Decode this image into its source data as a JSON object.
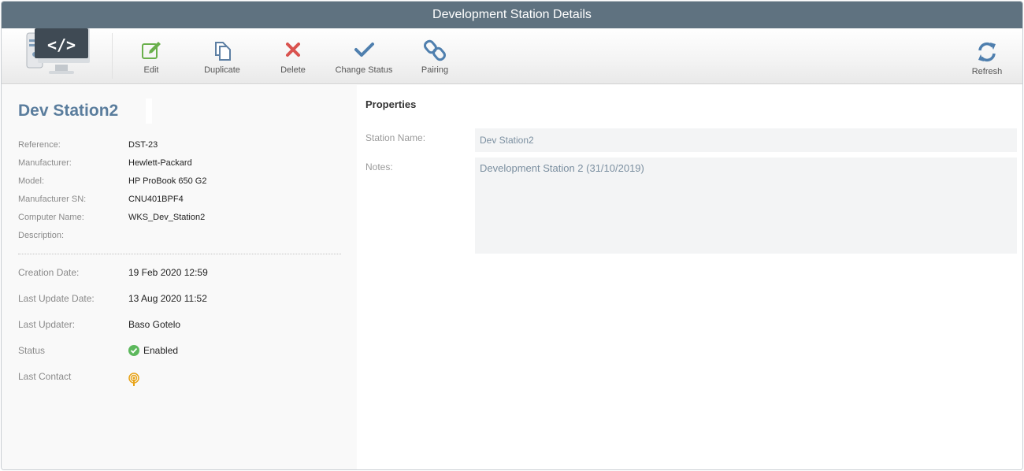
{
  "window": {
    "title": "Development Station Details"
  },
  "toolbar": {
    "buttons": [
      {
        "label": "Edit",
        "icon": "edit-icon",
        "color": "#6ab04c"
      },
      {
        "label": "Duplicate",
        "icon": "duplicate-icon",
        "color": "#5d7fa3"
      },
      {
        "label": "Delete",
        "icon": "delete-icon",
        "color": "#d9534f"
      },
      {
        "label": "Change Status",
        "icon": "check-icon",
        "color": "#4f7fae"
      },
      {
        "label": "Pairing",
        "icon": "link-icon",
        "color": "#4f7fae"
      }
    ],
    "refresh_label": "Refresh"
  },
  "station": {
    "name": "Dev Station2",
    "details": [
      {
        "key": "Reference:",
        "value": "DST-23"
      },
      {
        "key": "Manufacturer:",
        "value": "Hewlett-Packard"
      },
      {
        "key": "Model:",
        "value": "HP ProBook 650 G2"
      },
      {
        "key": "Manufacturer SN:",
        "value": "CNU401BPF4"
      },
      {
        "key": "Computer Name:",
        "value": "WKS_Dev_Station2"
      },
      {
        "key": "Description:",
        "value": ""
      }
    ],
    "meta": [
      {
        "key": "Creation Date:",
        "value": "19 Feb 2020 12:59"
      },
      {
        "key": "Last Update Date:",
        "value": "13 Aug 2020 11:52"
      },
      {
        "key": "Last Updater:",
        "value": "Baso Gotelo"
      }
    ],
    "status_label": "Status",
    "status_value": "Enabled",
    "last_contact_label": "Last Contact"
  },
  "properties": {
    "title": "Properties",
    "station_name_label": "Station Name:",
    "station_name_value": "Dev Station2",
    "notes_label": "Notes:",
    "notes_value": "Development Station 2 (31/10/2019)"
  },
  "colors": {
    "titlebar": "#5f7280",
    "accent": "#5a7d9d",
    "enabled": "#5cb85c",
    "contact": "#e8a317"
  }
}
